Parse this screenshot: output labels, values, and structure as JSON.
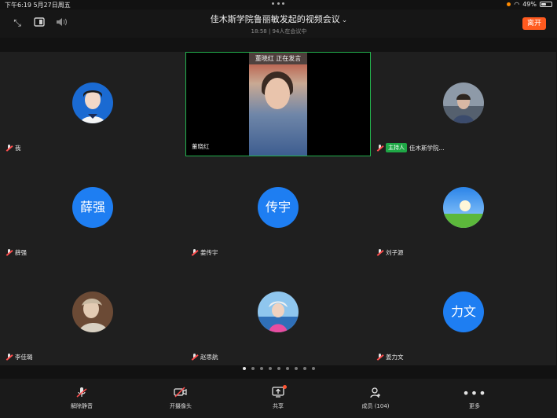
{
  "status_bar": {
    "time": "下午6:19  5月27日周五",
    "battery": "49%",
    "battery_level": 0.49
  },
  "header": {
    "title": "佳木斯学院鲁丽敏发起的视频会议",
    "subtitle": "18:58  |  94人在会议中",
    "leave_label": "离开",
    "icons": [
      "collapse-icon",
      "layout-icon",
      "speaker-icon"
    ],
    "leave_color": "#ff5a1f"
  },
  "speaking_banner": "董晓红  正在发言",
  "tiles": [
    {
      "name": "我",
      "avatar_type": "photo"
    },
    {
      "name": "董晓红",
      "avatar_type": "video"
    },
    {
      "name": "佳木斯学院...",
      "host_badge": "主持人",
      "avatar_type": "photo"
    },
    {
      "name": "薛强",
      "avatar_text": "薛强",
      "avatar_type": "text"
    },
    {
      "name": "姜传宇",
      "avatar_text": "传宇",
      "avatar_type": "text"
    },
    {
      "name": "刘子源",
      "avatar_type": "photo"
    },
    {
      "name": "李佳璐",
      "avatar_type": "photo"
    },
    {
      "name": "赵思航",
      "avatar_type": "photo"
    },
    {
      "name": "姜力文",
      "avatar_text": "力文",
      "avatar_type": "text"
    }
  ],
  "pager": {
    "pages": 9,
    "current": 1
  },
  "toolbar": {
    "items": [
      {
        "label": "解除静音",
        "icon": "mic-muted-icon"
      },
      {
        "label": "开摄像头",
        "icon": "camera-off-icon"
      },
      {
        "label": "共享",
        "icon": "share-screen-icon"
      },
      {
        "label": "成员 (104)",
        "icon": "members-icon"
      },
      {
        "label": "更多",
        "icon": "more-icon"
      }
    ]
  },
  "colors": {
    "accent_blue": "#1e7ef2",
    "active_speaker_border": "#23b14d",
    "host_badge": "#1fa846"
  }
}
